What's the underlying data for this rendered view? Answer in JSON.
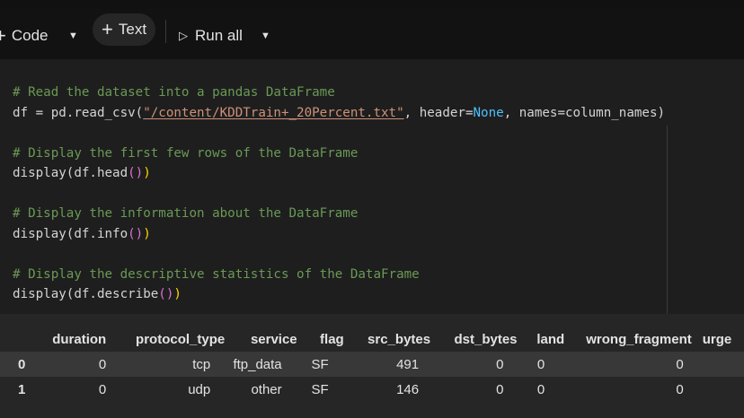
{
  "toolbar": {
    "code_label": "Code",
    "text_label": "Text",
    "run_all_label": "Run all"
  },
  "code": {
    "lines": [
      {
        "comment": "# Read the dataset into a pandas DataFrame"
      },
      {
        "pre": "df = pd.read_csv(",
        "string": "\"/content/KDDTrain+_20Percent.txt\"",
        "mid": ", header=",
        "keyword": "None",
        "post": ", names=column_names)"
      },
      {
        "blank": ""
      },
      {
        "comment": "# Display the first few rows of the DataFrame"
      },
      {
        "call": "display(df.head",
        "inner": "()",
        "close": ")"
      },
      {
        "blank": ""
      },
      {
        "comment": "# Display the information about the DataFrame"
      },
      {
        "call": "display(df.info",
        "inner": "()",
        "close": ")"
      },
      {
        "blank": ""
      },
      {
        "comment": "# Display the descriptive statistics of the DataFrame"
      },
      {
        "call": "display(df.describe",
        "inner": "()",
        "close": ")"
      }
    ]
  },
  "output_table": {
    "columns": [
      "duration",
      "protocol_type",
      "service",
      "flag",
      "src_bytes",
      "dst_bytes",
      "land",
      "wrong_fragment",
      "urge"
    ],
    "rows": [
      {
        "index": "0",
        "cells": [
          "0",
          "tcp",
          "ftp_data",
          "SF",
          "491",
          "0",
          "0",
          "0",
          ""
        ]
      },
      {
        "index": "1",
        "cells": [
          "0",
          "udp",
          "other",
          "SF",
          "146",
          "0",
          "0",
          "0",
          ""
        ]
      }
    ]
  },
  "colors": {
    "background": "#1e1e1e",
    "toolbar": "#121212",
    "comment": "#6a9955",
    "string": "#ce9178",
    "keyword": "#4fc1ff",
    "paren": "#ffd700"
  }
}
